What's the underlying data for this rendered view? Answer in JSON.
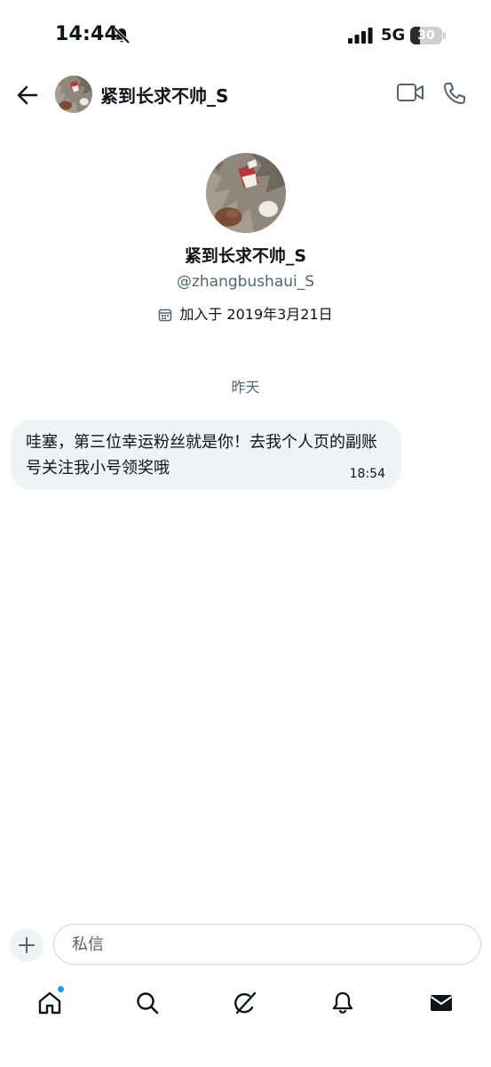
{
  "status_bar": {
    "time": "14:44",
    "network": "5G",
    "battery": "30",
    "battery_level": 0.3,
    "icons": [
      "bell-off-icon",
      "signal-icon"
    ]
  },
  "header": {
    "title": "紧到长求不帅_S",
    "icons": [
      "back-arrow-icon",
      "video-call-icon",
      "phone-icon"
    ]
  },
  "profile": {
    "name": "紧到长求不帅_S",
    "handle": "@zhangbushaui_S",
    "joined": "加入于 2019年3月21日"
  },
  "conversation": {
    "day_separator": "昨天",
    "messages": [
      {
        "text": "哇塞，第三位幸运粉丝就是你！去我个人页的副账号关注我小号领奖哦",
        "time": "18:54"
      }
    ]
  },
  "composer": {
    "placeholder": "私信"
  },
  "bottom_nav": {
    "items": [
      "home-icon",
      "search-icon",
      "grok-icon",
      "notifications-icon",
      "messages-icon"
    ],
    "accent_color": "#1d9bf0"
  },
  "colors": {
    "text": "#0f1419",
    "secondary_text": "#536471",
    "bubble": "#eff3f4"
  }
}
